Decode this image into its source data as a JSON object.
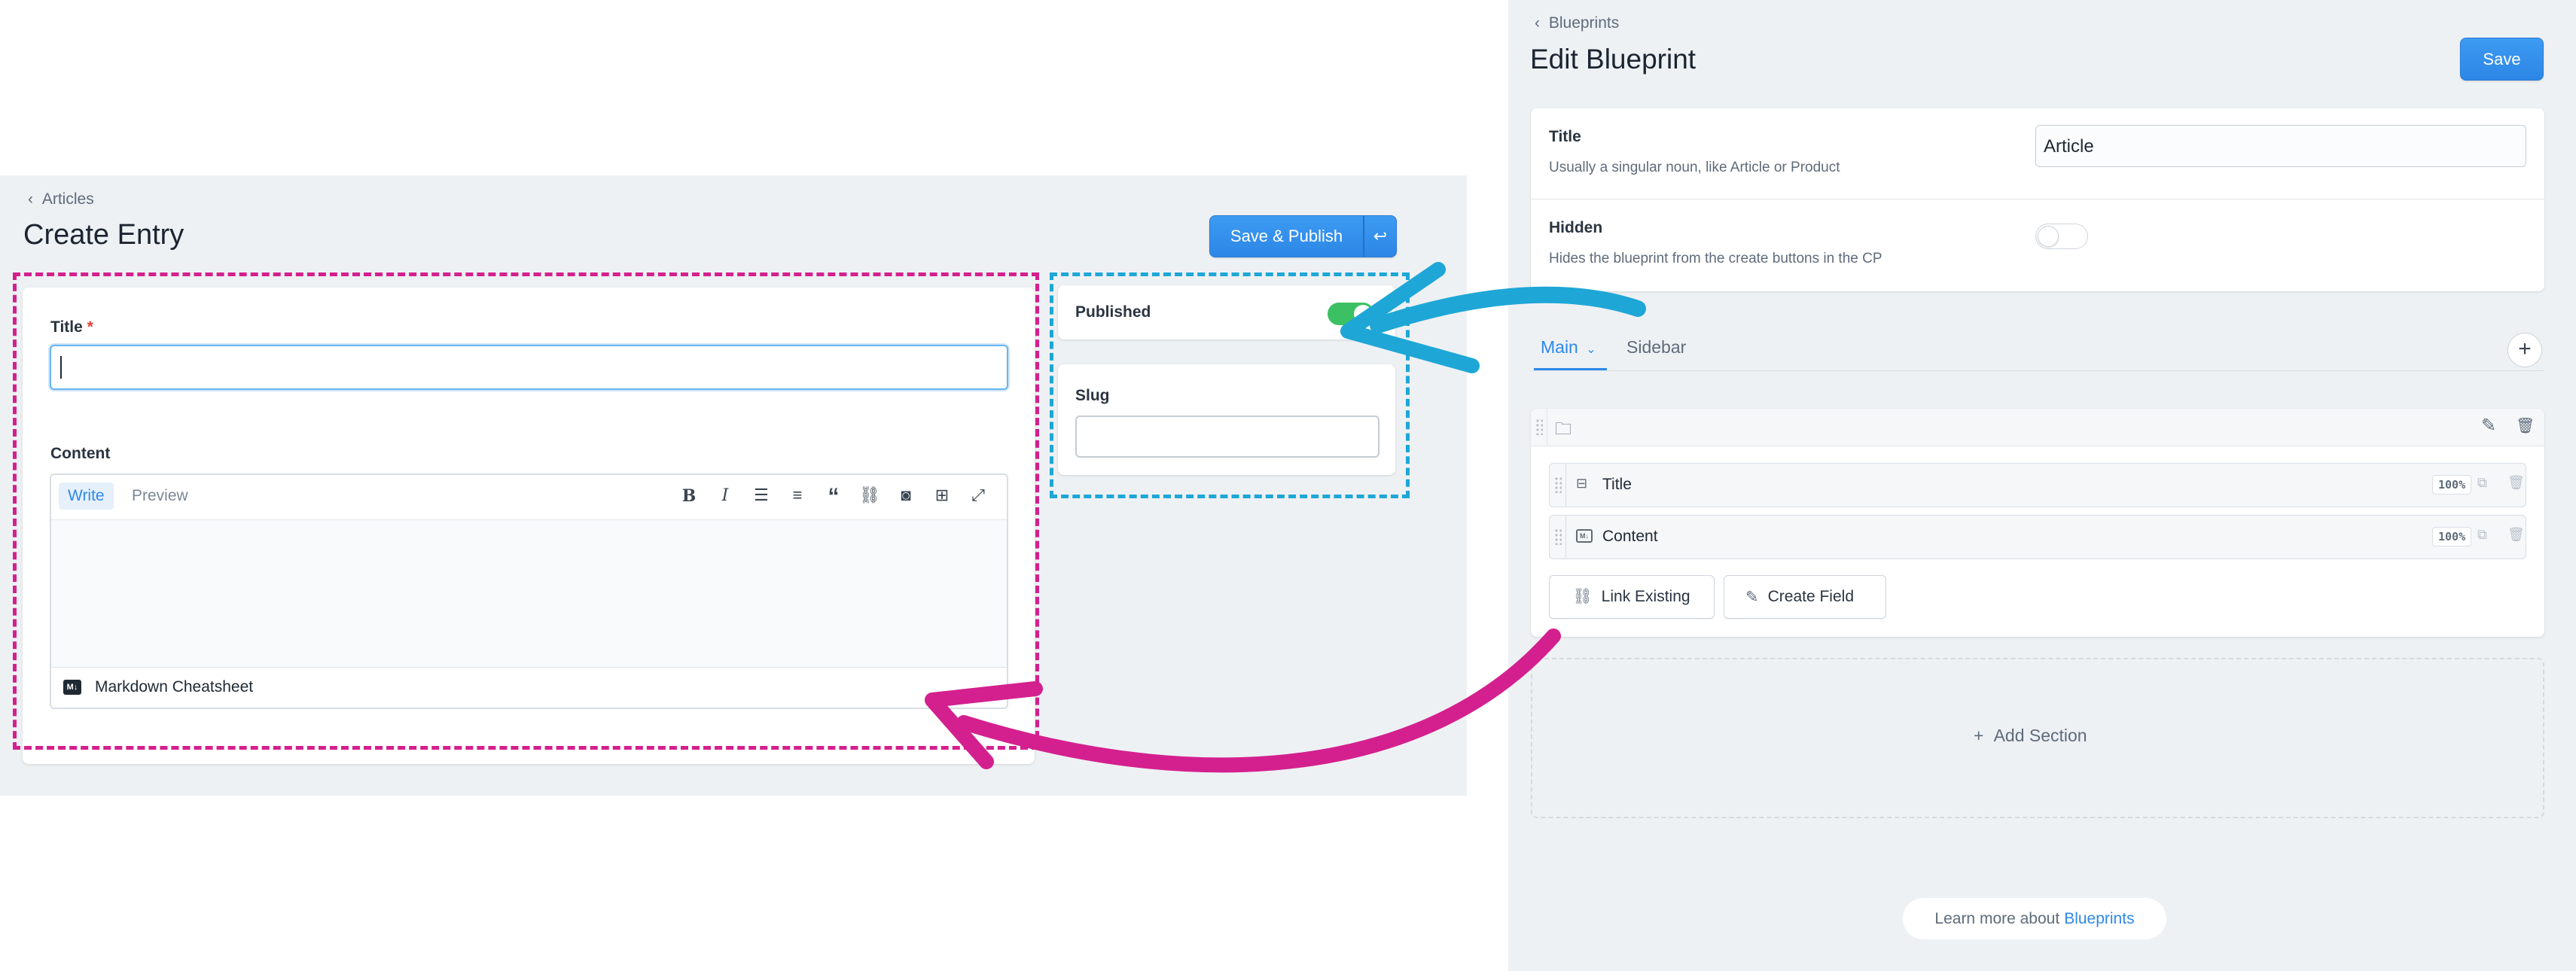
{
  "left": {
    "breadcrumb": "Articles",
    "title": "Create Entry",
    "save_publish_label": "Save & Publish",
    "title_label": "Title",
    "required_mark": "*",
    "content_label": "Content",
    "tabs": {
      "write": "Write",
      "preview": "Preview"
    },
    "cheatsheet_label": "Markdown Cheatsheet",
    "published_label": "Published",
    "slug_label": "Slug",
    "title_value": "",
    "slug_value": ""
  },
  "right": {
    "breadcrumb": "Blueprints",
    "title": "Edit Blueprint",
    "save_label": "Save",
    "title_field": {
      "label": "Title",
      "help": "Usually a singular noun, like Article or Product",
      "value": "Article"
    },
    "hidden_field": {
      "label": "Hidden",
      "help": "Hides the blueprint from the create buttons in the CP"
    },
    "tabs": [
      {
        "label": "Main",
        "active": true
      },
      {
        "label": "Sidebar",
        "active": false
      }
    ],
    "fields": [
      {
        "label": "Title",
        "width": "100%",
        "icon": "text-field-icon"
      },
      {
        "label": "Content",
        "width": "100%",
        "icon": "markdown-icon"
      }
    ],
    "link_existing_label": "Link Existing",
    "create_field_label": "Create Field",
    "add_section_label": "Add Section",
    "learn_more_prefix": "Learn more about",
    "learn_more_link": "Blueprints"
  },
  "colors": {
    "accent": "#2d89e8",
    "annotation_pink": "#d4208e",
    "annotation_blue": "#1ea7d6",
    "toggle_on": "#3cc064"
  }
}
